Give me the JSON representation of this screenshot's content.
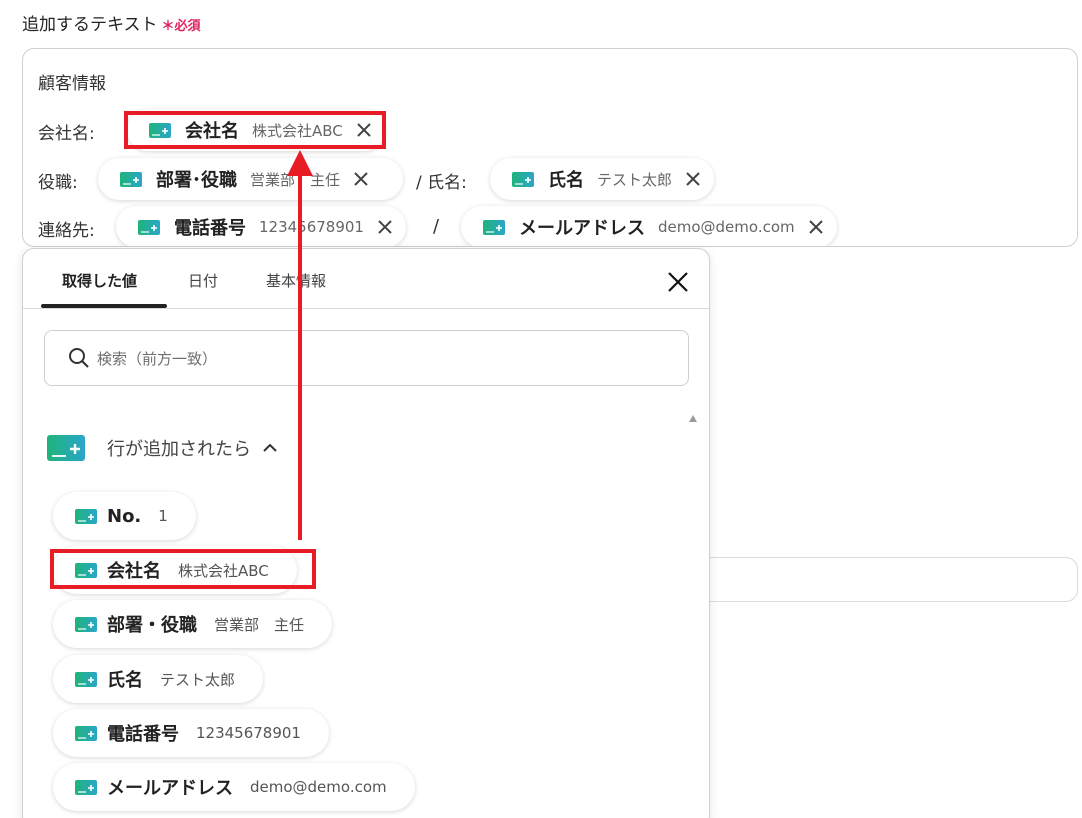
{
  "field": {
    "label": "追加するテキスト",
    "required_mark": "＊",
    "required_text": "必須"
  },
  "editor": {
    "heading": "顧客情報",
    "company_label": "会社名:",
    "title_label": "役職:",
    "name_label": "/ 氏名:",
    "contact_label": "連絡先:",
    "slash": "/",
    "chips": {
      "company": {
        "name": "会社名",
        "value": "株式会社ABC"
      },
      "dept": {
        "name": "部署･役職",
        "value": "営業部　主任"
      },
      "person": {
        "name": "氏名",
        "value": "テスト太郎"
      },
      "phone": {
        "name": "電話番号",
        "value": "12345678901"
      },
      "email": {
        "name": "メールアドレス",
        "value": "demo@demo.com"
      }
    }
  },
  "popup": {
    "tabs": [
      "取得した値",
      "日付",
      "基本情報"
    ],
    "active_tab": "取得した値",
    "search_placeholder": "検索（前方一致）",
    "group_label": "行が追加されたら",
    "items": [
      {
        "name": "No.",
        "value": "1"
      },
      {
        "name": "会社名",
        "value": "株式会社ABC"
      },
      {
        "name": "部署・役職",
        "value": "営業部　主任"
      },
      {
        "name": "氏名",
        "value": "テスト太郎"
      },
      {
        "name": "電話番号",
        "value": "12345678901"
      },
      {
        "name": "メールアドレス",
        "value": "demo@demo.com"
      }
    ]
  },
  "colors": {
    "accent_red": "#e81c24",
    "required_pink": "#e0245e",
    "sheet_green": "#1fb37a",
    "sheet_teal": "#2aa6c9"
  }
}
